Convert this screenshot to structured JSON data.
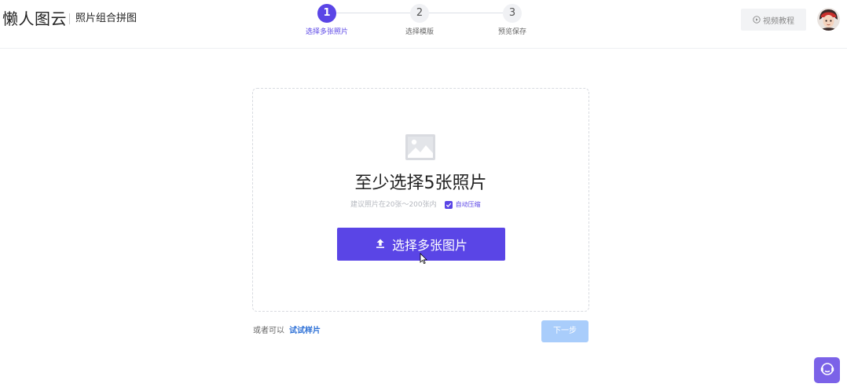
{
  "header": {
    "logo": "懒人图云",
    "subtitle": "照片组合拼图",
    "steps": [
      {
        "number": "1",
        "label": "选择多张照片",
        "active": true
      },
      {
        "number": "2",
        "label": "选择模版",
        "active": false
      },
      {
        "number": "3",
        "label": "预览保存",
        "active": false
      }
    ],
    "video_tutorial_label": "视频教程",
    "icons": {
      "video": "play-circle-icon",
      "avatar": "user-avatar"
    }
  },
  "upload": {
    "icon": "image-placeholder-icon",
    "title": "至少选择5张照片",
    "hint": "建议照片在20张～200张内",
    "auto_compress_label": "自动压缩",
    "auto_compress_checked": true,
    "select_button_label": "选择多张图片",
    "select_button_icon": "upload-icon"
  },
  "footer": {
    "or_text": "或者可以",
    "sample_link": "试试样片",
    "next_button_label": "下一步"
  },
  "support": {
    "icon": "customer-service-icon"
  },
  "colors": {
    "accent": "#5a45e6",
    "link": "#2b6fd6",
    "next_disabled": "#a9cdfb",
    "support": "#7b62e8"
  }
}
